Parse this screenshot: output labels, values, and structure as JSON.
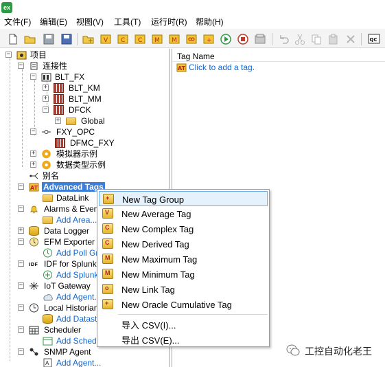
{
  "app": {
    "logo_text": "ex"
  },
  "menubar": {
    "items": [
      "文件(F)",
      "编辑(E)",
      "视图(V)",
      "工具(T)",
      "运行时(R)",
      "帮助(H)"
    ]
  },
  "toolbar": {
    "icons": [
      "new-file-icon",
      "open-folder-icon",
      "save-icon",
      "save-all-icon",
      "new-tag-group-icon",
      "new-average-tag-icon",
      "new-complex-tag-icon",
      "new-derived-tag-icon",
      "new-maximum-tag-icon",
      "new-minimum-tag-icon",
      "new-link-tag-icon",
      "new-cumulative-tag-icon",
      "start-runtime-icon",
      "stop-runtime-icon",
      "properties-icon",
      "undo-icon",
      "cut-icon",
      "copy-icon",
      "paste-icon",
      "delete-icon",
      "quick-client-icon"
    ],
    "quick_client_label": "QC"
  },
  "tree": {
    "root": "项目",
    "connectivity": "连接性",
    "blt_fx": "BLT_FX",
    "blt_km": "BLT_KM",
    "blt_mm": "BLT_MM",
    "dfck": "DFCK",
    "global": "Global",
    "fxy_opc": "FXY_OPC",
    "dfmc_fxy": "DFMC_FXY",
    "simulator_example": "模拟器示例",
    "data_type_example": "数据类型示例",
    "alias": "别名",
    "advanced_tags": "Advanced Tags",
    "datalink": "DataLink",
    "alarms_events": "Alarms & Events",
    "add_area": "Add Area...",
    "data_logger": "Data Logger",
    "efm_exporter": "EFM Exporter",
    "add_poll_group": "Add Poll Gro",
    "idf_for_splunk": "IDF for Splunk",
    "add_splunk": "Add Splunk",
    "iot_gateway": "IoT Gateway",
    "add_agent_iot": "Add Agent...",
    "local_historian": "Local Historian",
    "add_datastore": "Add Datasto",
    "scheduler": "Scheduler",
    "add_schedule": "Add Schedu",
    "snmp_agent": "SNMP Agent",
    "add_agent_snmp": "Add Agent..."
  },
  "list": {
    "column_header": "Tag Name",
    "add_tag_text": "Click to add a tag."
  },
  "context_menu": {
    "items": [
      {
        "label": "New Tag Group",
        "icon": "tag-group-icon",
        "mark": "+"
      },
      {
        "label": "New Average Tag",
        "icon": "average-tag-icon",
        "mark": "V"
      },
      {
        "label": "New Complex Tag",
        "icon": "complex-tag-icon",
        "mark": "C"
      },
      {
        "label": "New Derived Tag",
        "icon": "derived-tag-icon",
        "mark": "C"
      },
      {
        "label": "New Maximum Tag",
        "icon": "maximum-tag-icon",
        "mark": "M"
      },
      {
        "label": "New Minimum Tag",
        "icon": "minimum-tag-icon",
        "mark": "M"
      },
      {
        "label": "New Link Tag",
        "icon": "link-tag-icon",
        "mark": "o"
      },
      {
        "label": "New Oracle Cumulative Tag",
        "icon": "cumulative-tag-icon",
        "mark": "+"
      },
      {
        "label": "导入 CSV(I)..."
      },
      {
        "label": "导出 CSV(E)..."
      }
    ]
  },
  "watermark": {
    "text": "工控自动化老王"
  },
  "colors": {
    "selection": "#3c7fd8",
    "link": "#0b66d6",
    "menu_highlight": "#e5f1fb"
  }
}
